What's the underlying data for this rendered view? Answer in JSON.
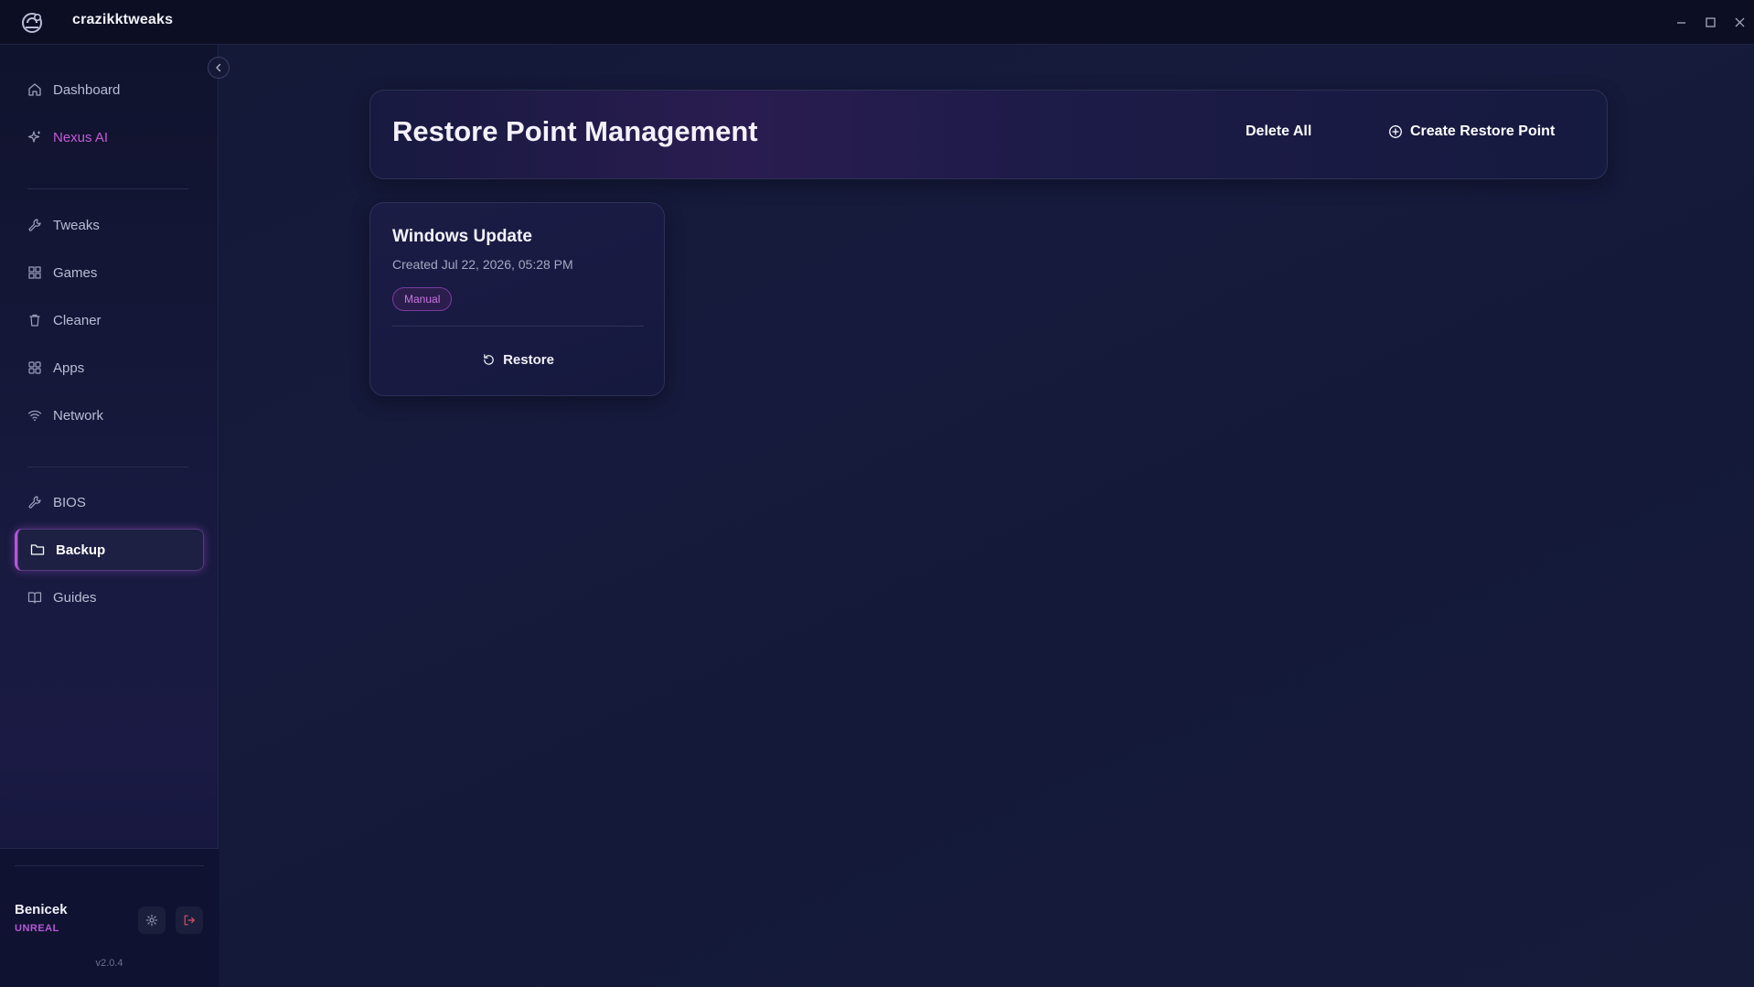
{
  "app": {
    "name": "crazikktweaks"
  },
  "window_controls": {
    "minimize": "minimize-icon",
    "maximize": "maximize-icon",
    "close": "close-icon"
  },
  "sidebar": {
    "items": [
      {
        "label": "Dashboard",
        "icon": "home-icon"
      },
      {
        "label": "Nexus AI",
        "icon": "sparkle-icon"
      },
      {
        "label": "Tweaks",
        "icon": "wrench-icon"
      },
      {
        "label": "Games",
        "icon": "grid-icon"
      },
      {
        "label": "Cleaner",
        "icon": "trash-icon"
      },
      {
        "label": "Apps",
        "icon": "apps-icon"
      },
      {
        "label": "Network",
        "icon": "wifi-icon"
      },
      {
        "label": "BIOS",
        "icon": "wrench-icon"
      },
      {
        "label": "Backup",
        "icon": "folder-icon"
      },
      {
        "label": "Guides",
        "icon": "book-icon"
      }
    ],
    "active": "Backup",
    "accent_item": "Nexus AI"
  },
  "user": {
    "name": "Benicek",
    "tier": "UNREAL"
  },
  "version": "v2.0.4",
  "main": {
    "title": "Restore Point Management",
    "delete_all_label": "Delete All",
    "create_label": "Create Restore Point",
    "restore_points": [
      {
        "name": "Windows Update",
        "created": "Created Jul 22, 2026, 05:28 PM",
        "badge": "Manual",
        "restore_label": "Restore"
      }
    ]
  },
  "colors": {
    "accent": "#b657d6",
    "background": "#141938",
    "sidebar": "#10132d",
    "card_border": "#2c3158",
    "logout": "#e0506a"
  }
}
